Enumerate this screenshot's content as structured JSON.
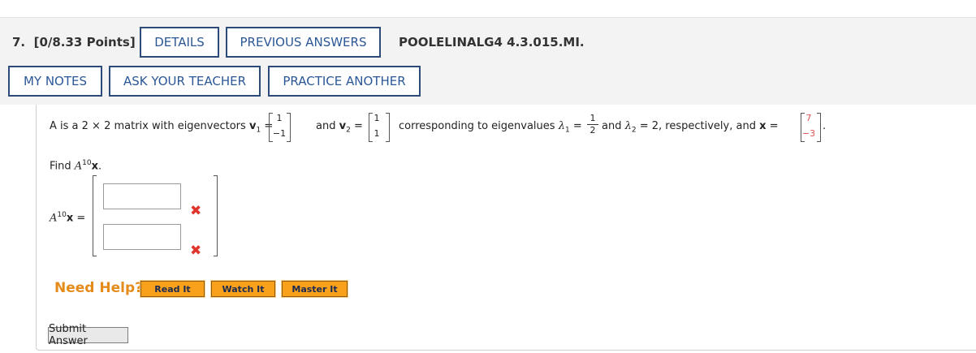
{
  "question": {
    "number_label": "7.",
    "points": "[0/8.33 Points]",
    "code": "POOLELINALG4 4.3.015.MI."
  },
  "buttons": {
    "details": "DETAILS",
    "previous_answers": "PREVIOUS ANSWERS",
    "my_notes": "MY NOTES",
    "ask_teacher": "ASK YOUR TEACHER",
    "practice_another": "PRACTICE ANOTHER"
  },
  "problem": {
    "intro": "A is a 2 × 2 matrix with eigenvectors",
    "v1_label": "v",
    "v1_sub": "1",
    "eq": "=",
    "v1": [
      "1",
      "−1"
    ],
    "and1": "and",
    "v2_label": "v",
    "v2_sub": "2",
    "v2": [
      "1",
      "1"
    ],
    "corresponding": "corresponding to eigenvalues",
    "lambda": "λ",
    "l1_sub": "1",
    "l1_num": "1",
    "l1_den": "2",
    "and2": "and",
    "l2_sub": "2",
    "l2_rest": "= 2, respectively, and",
    "x_label": "x",
    "x": [
      "7",
      "−3"
    ],
    "period": "."
  },
  "find": {
    "text": "Find",
    "A": "A",
    "power": "10",
    "x": "x",
    "period": "."
  },
  "answer": {
    "A": "A",
    "power": "10",
    "x": "x",
    "eq": "=",
    "values": [
      "",
      ""
    ],
    "status": [
      "incorrect",
      "incorrect"
    ],
    "mark": "✖"
  },
  "help": {
    "label": "Need Help?",
    "read_it": "Read It",
    "watch_it": "Watch It",
    "master_it": "Master It"
  },
  "submit": "Submit Answer",
  "colors": {
    "button_border": "#2c4a7a",
    "button_text": "#2b5797",
    "help_orange": "#e48b1a",
    "help_button_bg": "#f9a11b",
    "wrong_red": "#e0352b",
    "vector_red": "#d9534f"
  }
}
